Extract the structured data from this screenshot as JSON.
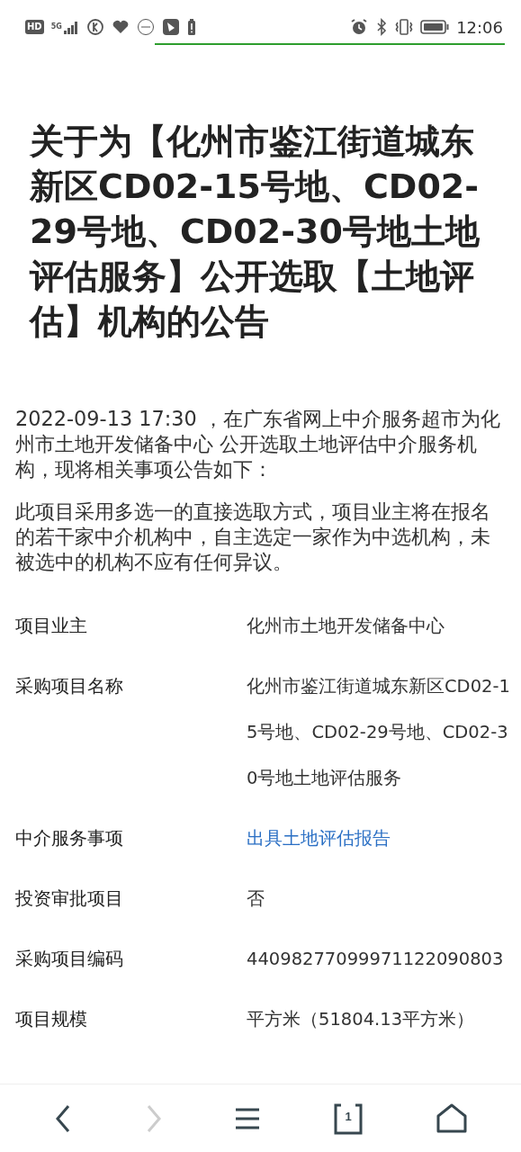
{
  "status_bar": {
    "hd": "HD",
    "network": "5G",
    "time": "12:06"
  },
  "title": "关于为【化州市鉴江街道城东新区CD02-15号地、CD02-29号地、CD02-30号地土地评估服务】公开选取【土地评估】机构的公告",
  "paragraphs": [
    "2022-09-13 17:30 ，在广东省网上中介服务超市为化州市土地开发储备中心 公开选取土地评估中介服务机构，现将相关事项公告如下：",
    "此项目采用多选一的直接选取方式，项目业主将在报名的若干家中介机构中，自主选定一家作为中选机构，未被选中的机构不应有任何异议。"
  ],
  "details": [
    {
      "label": "项目业主",
      "value": "化州市土地开发储备中心",
      "kind": "text"
    },
    {
      "label": "采购项目名称",
      "value": "化州市鉴江街道城东新区CD02-15号地、CD02-29号地、CD02-30号地土地评估服务",
      "kind": "text"
    },
    {
      "label": "中介服务事项",
      "value": "出具土地评估报告",
      "kind": "link"
    },
    {
      "label": "投资审批项目",
      "value": "否",
      "kind": "text"
    },
    {
      "label": "采购项目编码",
      "value": "44098277099971122090803",
      "kind": "text"
    },
    {
      "label": "项目规模",
      "value": "平方米（51804.13平方米）",
      "kind": "text"
    }
  ],
  "bottom_nav": {
    "back_disabled": false,
    "forward_disabled": true,
    "tab_count": "1"
  }
}
